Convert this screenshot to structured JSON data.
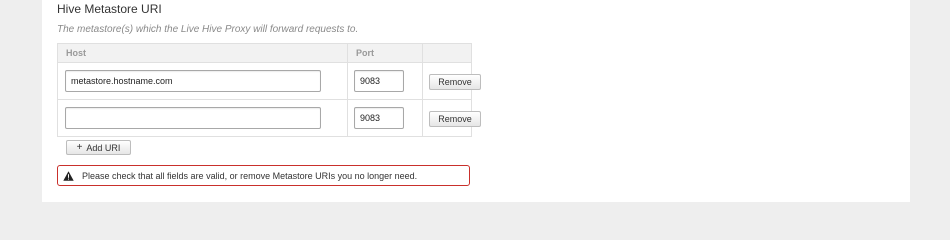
{
  "section": {
    "title": "Hive Metastore URI",
    "description": "The metastore(s) which the Live Hive Proxy will forward requests to."
  },
  "table": {
    "headers": {
      "host": "Host",
      "port": "Port"
    },
    "rows": [
      {
        "host": "metastore.hostname.com",
        "port": "9083",
        "remove_label": "Remove"
      },
      {
        "host": "",
        "port": "9083",
        "remove_label": "Remove"
      }
    ]
  },
  "add_button": {
    "icon": "plus-icon",
    "label": "Add URI"
  },
  "alert": {
    "icon": "warning-icon",
    "message": "Please check that all fields are valid, or remove Metastore URIs you no longer need.",
    "border_color": "#c9302c"
  }
}
